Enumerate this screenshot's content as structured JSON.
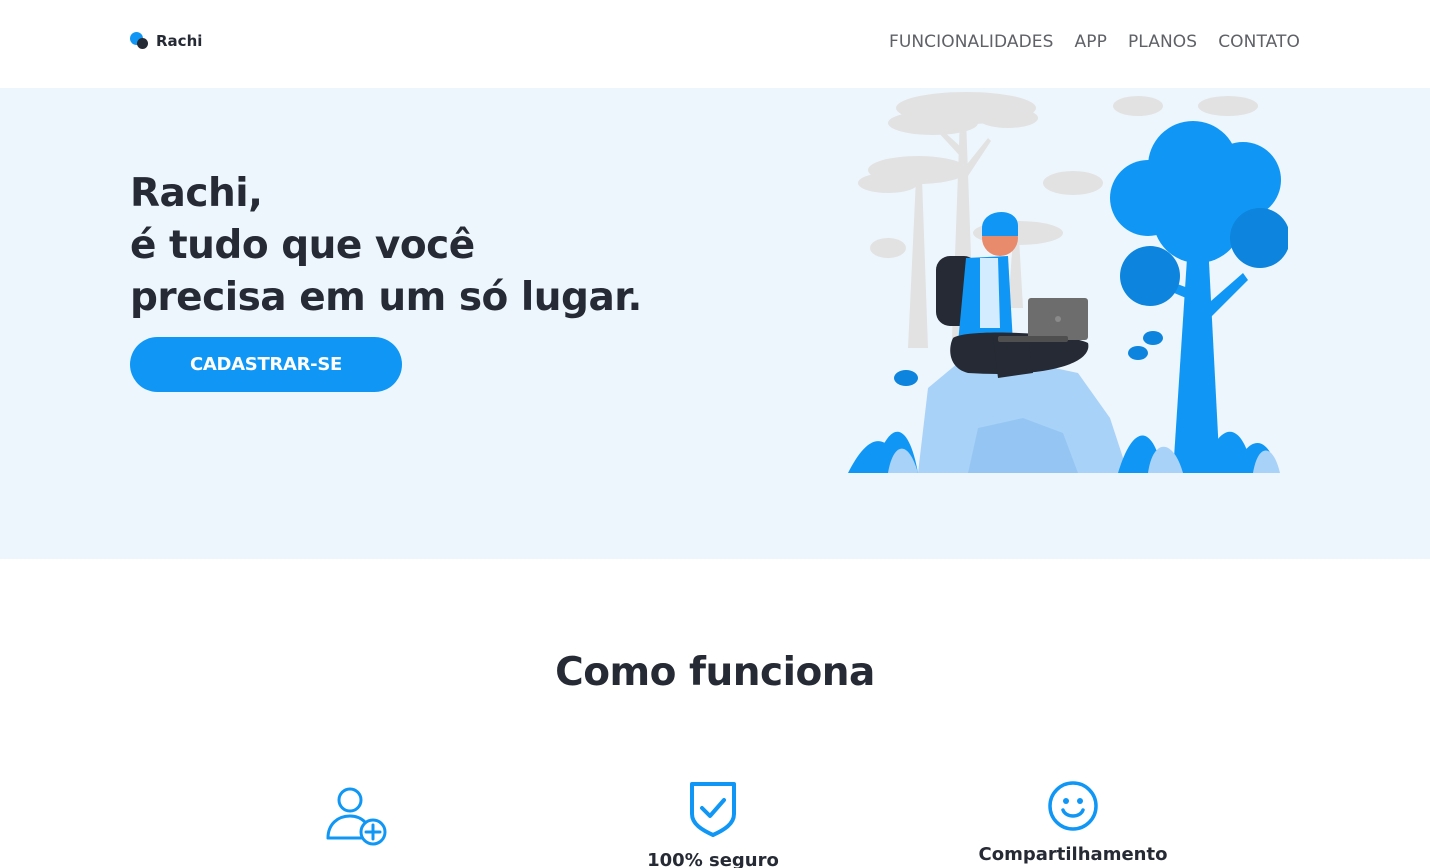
{
  "brand": {
    "name": "Rachi",
    "accent": "#1097f5",
    "dark": "#252a34"
  },
  "nav": [
    {
      "label": "FUNCIONALIDADES"
    },
    {
      "label": "APP"
    },
    {
      "label": "PLANOS"
    },
    {
      "label": "CONTATO"
    }
  ],
  "hero": {
    "line1": "Rachi,",
    "line2": "é tudo que você",
    "line3": "precisa em um só lugar.",
    "cta_label": "CADASTRAR-SE",
    "background": "#eef6fd"
  },
  "how_it_works": {
    "title": "Como funciona",
    "features": [
      {
        "icon": "add-user-icon",
        "label": ""
      },
      {
        "icon": "shield-check-icon",
        "label": "100% seguro"
      },
      {
        "icon": "smiley-icon",
        "label": "Compartilhamento"
      }
    ]
  }
}
